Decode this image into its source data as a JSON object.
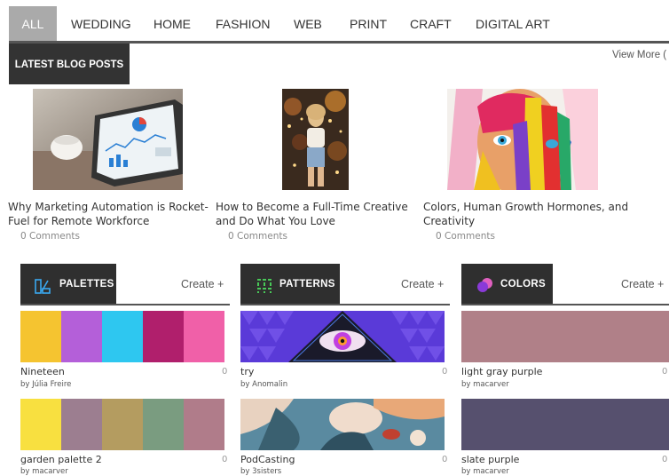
{
  "nav": {
    "items": [
      "ALL",
      "WEDDING",
      "HOME",
      "FASHION",
      "WEB",
      "PRINT",
      "CRAFT",
      "DIGITAL ART"
    ]
  },
  "blog": {
    "heading": "LATEST BLOG POSTS",
    "view_more": "View More (",
    "posts": [
      {
        "title": "Why Marketing Automation is Rocket-Fuel for Remote Workforce",
        "comments": "0 Comments"
      },
      {
        "title": "How to Become a Full-Time Creative and Do What You Love",
        "comments": "0 Comments"
      },
      {
        "title": "Colors, Human Growth Hormones, and Creativity",
        "comments": "0 Comments"
      }
    ]
  },
  "sections": {
    "palettes": {
      "label": "PALETTES",
      "create": "Create +",
      "items": [
        {
          "name": "Nineteen",
          "by": "by Júlia Freire",
          "count": "0",
          "colors": [
            "#f5c430",
            "#b45fd9",
            "#2ec7f0",
            "#b01f6c",
            "#f060a8"
          ]
        },
        {
          "name": "garden palette 2",
          "by": "by macarver",
          "count": "0",
          "colors": [
            "#f8e040",
            "#9c7e90",
            "#b49c60",
            "#7a9c80",
            "#b07c8a"
          ]
        }
      ]
    },
    "patterns": {
      "label": "PATTERNS",
      "create": "Create +",
      "items": [
        {
          "name": "try",
          "by": "by Anomalin",
          "count": "0"
        },
        {
          "name": "PodCasting",
          "by": "by 3sisters",
          "count": "0"
        }
      ]
    },
    "colors": {
      "label": "COLORS",
      "create": "Create +",
      "items": [
        {
          "name": "light gray purple",
          "by": "by macarver",
          "count": "0",
          "hex": "#b08088"
        },
        {
          "name": "slate purple",
          "by": "by macarver",
          "count": "0",
          "hex": "#56506e"
        }
      ]
    }
  }
}
